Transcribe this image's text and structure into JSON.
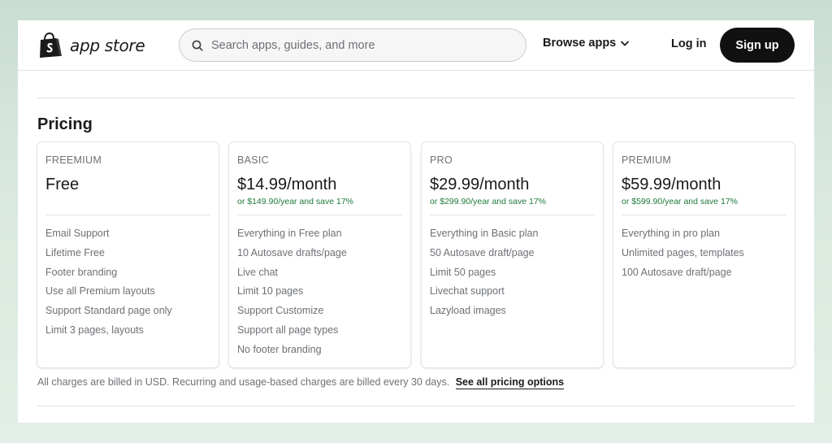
{
  "header": {
    "logo_text": "app store",
    "search_placeholder": "Search apps, guides, and more",
    "browse_label": "Browse apps",
    "login_label": "Log in",
    "signup_label": "Sign up"
  },
  "pricing": {
    "title": "Pricing",
    "plans": [
      {
        "name": "FREEMIUM",
        "price": "Free",
        "yearly": "",
        "features": [
          "Email Support",
          "Lifetime Free",
          "Footer branding",
          "Use all Premium layouts",
          "Support Standard page only",
          "Limit 3 pages, layouts"
        ]
      },
      {
        "name": "BASIC",
        "price": "$14.99/month",
        "yearly": "or $149.90/year and save 17%",
        "features": [
          "Everything in Free plan",
          "10 Autosave drafts/page",
          "Live chat",
          "Limit 10 pages",
          "Support Customize",
          "Support all page types",
          "No footer branding"
        ]
      },
      {
        "name": "PRO",
        "price": "$29.99/month",
        "yearly": "or $299.90/year and save 17%",
        "features": [
          "Everything in Basic plan",
          "50 Autosave draft/page",
          "Limit 50 pages",
          "Livechat support",
          "Lazyload images"
        ]
      },
      {
        "name": "PREMIUM",
        "price": "$59.99/month",
        "yearly": "or $599.90/year and save 17%",
        "features": [
          "Everything in pro plan",
          "Unlimited pages, templates",
          "100 Autosave draft/page"
        ]
      }
    ],
    "footnote": "All charges are billed in USD. Recurring and usage-based charges are billed every 30 days.",
    "see_all_label": "See all pricing options"
  },
  "colors": {
    "accent_green": "#1f7a3a",
    "signup_bg": "#111111"
  },
  "icons": {
    "logo": "shopping-bag-icon",
    "search": "search-icon",
    "browse": "chevron-down-icon"
  }
}
